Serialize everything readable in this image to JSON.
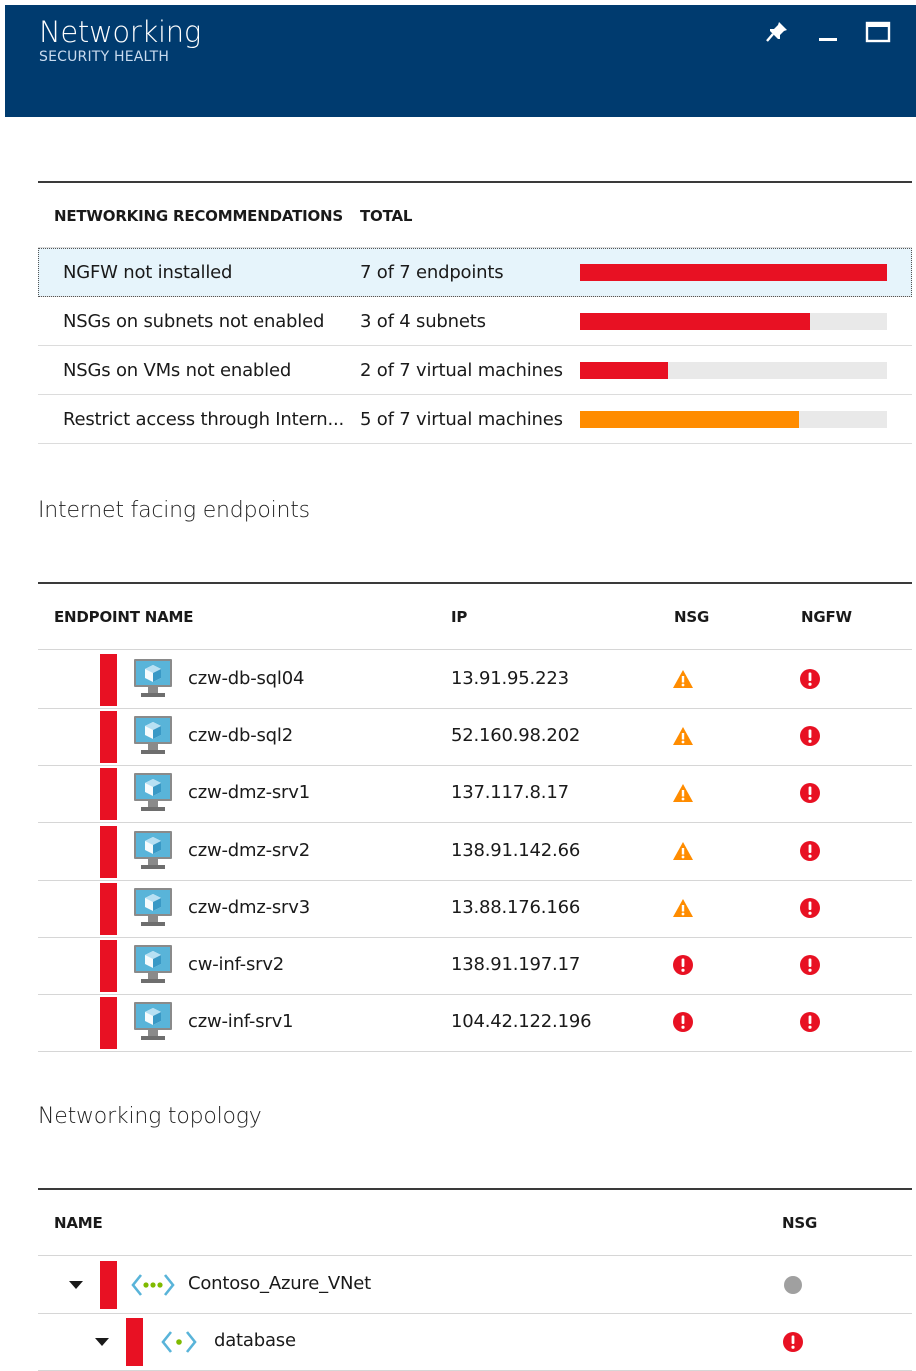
{
  "header": {
    "title": "Networking",
    "subtitle": "SECURITY HEALTH",
    "bg_color": "#003b6f",
    "buttons": [
      "pin-icon",
      "minimize-icon",
      "maximize-icon"
    ]
  },
  "recommendations": {
    "headers": {
      "name": "NETWORKING RECOMMENDATIONS",
      "total": "TOTAL"
    },
    "rows": [
      {
        "name": "NGFW not installed",
        "total": "7 of 7 endpoints",
        "fraction": 1.0,
        "color": "#e81123",
        "selected": true
      },
      {
        "name": "NSGs on subnets not enabled",
        "total": "3 of 4 subnets",
        "fraction": 0.75,
        "color": "#e81123",
        "selected": false
      },
      {
        "name": "NSGs on VMs not enabled",
        "total": "2 of 7 virtual machines",
        "fraction": 0.2857,
        "color": "#e81123",
        "selected": false
      },
      {
        "name": "Restrict access through Intern...",
        "total": "5 of 7 virtual machines",
        "fraction": 0.7143,
        "color": "#ff8c00",
        "selected": false
      }
    ]
  },
  "endpoints": {
    "section_title": "Internet facing endpoints",
    "headers": {
      "name": "ENDPOINT NAME",
      "ip": "IP",
      "nsg": "NSG",
      "ngfw": "NGFW"
    },
    "rows": [
      {
        "name": "czw-db-sql04",
        "ip": "13.91.95.223",
        "nsg": "warning",
        "ngfw": "error"
      },
      {
        "name": "czw-db-sql2",
        "ip": "52.160.98.202",
        "nsg": "warning",
        "ngfw": "error"
      },
      {
        "name": "czw-dmz-srv1",
        "ip": "137.117.8.17",
        "nsg": "warning",
        "ngfw": "error"
      },
      {
        "name": "czw-dmz-srv2",
        "ip": "138.91.142.66",
        "nsg": "warning",
        "ngfw": "error"
      },
      {
        "name": "czw-dmz-srv3",
        "ip": "13.88.176.166",
        "nsg": "warning",
        "ngfw": "error"
      },
      {
        "name": "cw-inf-srv2",
        "ip": "138.91.197.17",
        "nsg": "error",
        "ngfw": "error"
      },
      {
        "name": "czw-inf-srv1",
        "ip": "104.42.122.196",
        "nsg": "error",
        "ngfw": "error"
      }
    ]
  },
  "topology": {
    "section_title": "Networking topology",
    "headers": {
      "name": "NAME",
      "nsg": "NSG"
    },
    "rows": [
      {
        "name": "Contoso_Azure_VNet",
        "level": 0,
        "nsg": "none",
        "icon": "vnet-icon"
      },
      {
        "name": "database",
        "level": 1,
        "nsg": "error",
        "icon": "subnet-icon"
      }
    ]
  },
  "colors": {
    "error": "#e81123",
    "warning": "#ff8c00",
    "neutral": "#a0a0a0",
    "accent": "#003b6f"
  }
}
